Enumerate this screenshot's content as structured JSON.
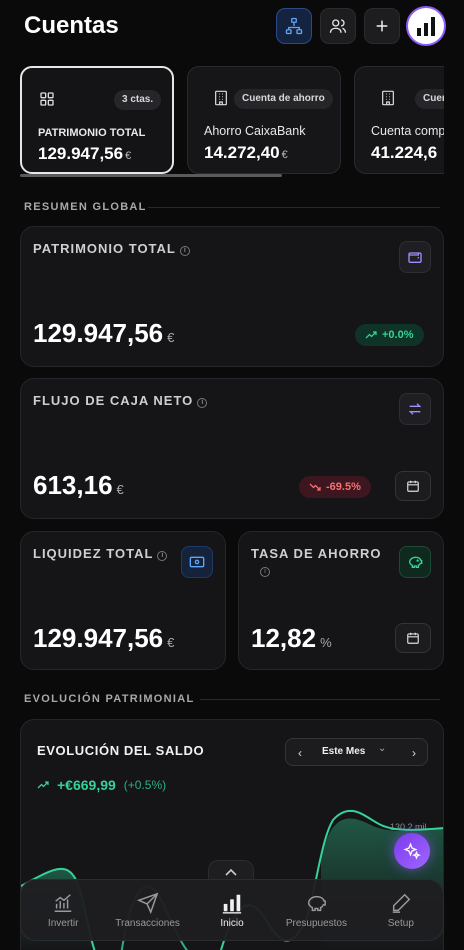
{
  "header": {
    "title": "Cuentas",
    "buttons": [
      "org-chart-icon",
      "users-icon",
      "plus-icon"
    ]
  },
  "accounts": [
    {
      "name": "PATRIMONIO TOTAL",
      "badge": "3 ctas.",
      "value": "129.947,56",
      "currency": "€",
      "icon": "grid-icon",
      "selected": true
    },
    {
      "name": "Ahorro CaixaBank",
      "badge": "Cuenta de ahorro",
      "value": "14.272,40",
      "currency": "€",
      "icon": "building-icon"
    },
    {
      "name": "Cuenta comp",
      "badge": "Cuen",
      "value": "41.224,6",
      "currency": "",
      "icon": "building-icon"
    }
  ],
  "sections": {
    "summary": "RESUMEN GLOBAL",
    "evolution": "EVOLUCIÓN PATRIMONIAL"
  },
  "cards": {
    "net_worth": {
      "label": "PATRIMONIO TOTAL",
      "value": "129.947,56",
      "currency": "€",
      "change": "+0.0%"
    },
    "cash_flow": {
      "label": "FLUJO DE CAJA NETO",
      "value": "613,16",
      "currency": "€",
      "change": "-69.5%"
    },
    "liquidity": {
      "label": "LIQUIDEZ TOTAL",
      "value": "129.947,56",
      "currency": "€"
    },
    "savings_rate": {
      "label": "TASA DE AHORRO",
      "value": "12,82",
      "unit": "%"
    }
  },
  "chart": {
    "title": "EVOLUCIÓN DEL SALDO",
    "period": "Este Mes",
    "delta": "+€669,99",
    "delta_pct": "(+0.5%)",
    "max_label": "130,2 mil"
  },
  "colors": {
    "accent": "#8b5cf6",
    "positive": "#34d399",
    "negative": "#f87171",
    "blue": "#3b82f6"
  },
  "nav": [
    {
      "label": "Invertir",
      "icon": "chart-line-icon"
    },
    {
      "label": "Transacciones",
      "icon": "send-icon"
    },
    {
      "label": "Inicio",
      "icon": "bar-chart-icon",
      "active": true
    },
    {
      "label": "Presupuestos",
      "icon": "piggy-bank-icon"
    },
    {
      "label": "Setup",
      "icon": "pen-icon"
    }
  ]
}
